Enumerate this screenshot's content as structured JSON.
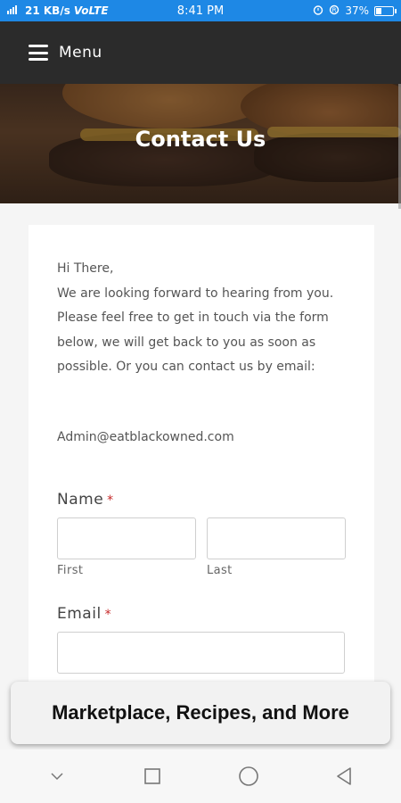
{
  "status_bar": {
    "speed": "21 KB/s",
    "network": "VoLTE",
    "time": "8:41 PM",
    "battery_percent": "37%",
    "battery_level": 0.37
  },
  "header": {
    "menu_label": "Menu"
  },
  "hero": {
    "title": "Contact Us"
  },
  "intro": {
    "greeting": "Hi There,",
    "body": "We are looking forward to hearing from you. Please feel free to get in touch via the form below, we will get back to you as soon as possible.  Or you can contact us by email:",
    "email": "Admin@eatblackowned.com"
  },
  "form": {
    "name_label": "Name",
    "required_mark": "*",
    "first_sublabel": "First",
    "last_sublabel": "Last",
    "email_label": "Email"
  },
  "promo": {
    "text": "Marketplace, Recipes, and More"
  },
  "navbar": {
    "icons": [
      "chevron-down-icon",
      "recent-apps-icon",
      "home-icon",
      "back-icon"
    ]
  }
}
